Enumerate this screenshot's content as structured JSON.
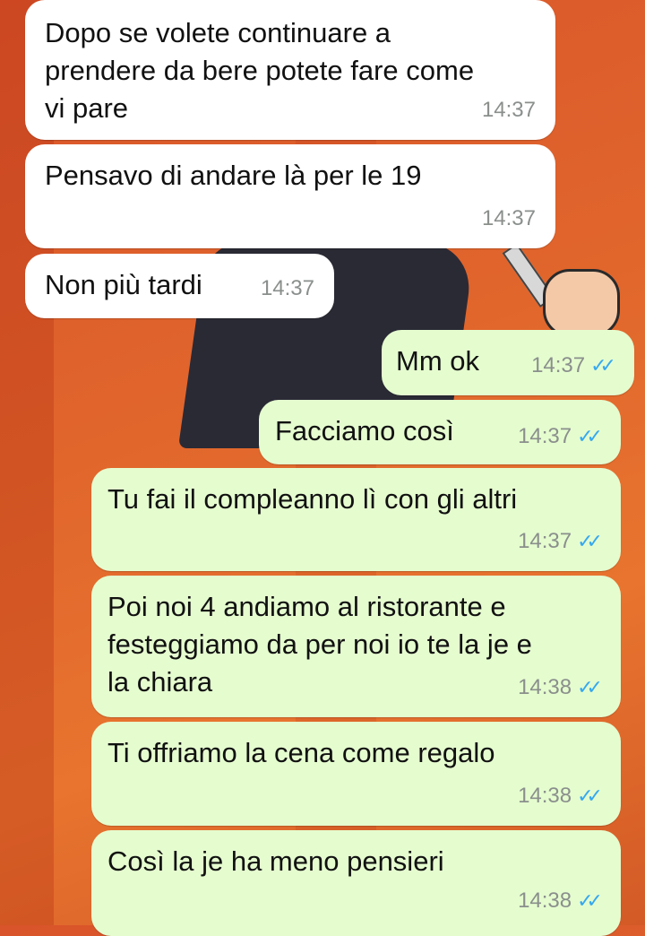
{
  "messages": [
    {
      "direction": "in",
      "text": "Dopo se volete continuare a\nprendere da bere potete fare come\nvi pare",
      "time": "14:37"
    },
    {
      "direction": "in",
      "text": "Pensavo di andare là per le 19",
      "time": "14:37"
    },
    {
      "direction": "in",
      "text": "Non più tardi",
      "time": "14:37"
    },
    {
      "direction": "out",
      "text": "Mm ok",
      "time": "14:37",
      "status": "read"
    },
    {
      "direction": "out",
      "text": "Facciamo così",
      "time": "14:37",
      "status": "read"
    },
    {
      "direction": "out",
      "text": "Tu fai il compleanno lì con gli altri",
      "time": "14:37",
      "status": "read"
    },
    {
      "direction": "out",
      "text": "Poi noi 4 andiamo al ristorante e\nfesteggiamo da per noi io te la je e\nla chiara",
      "time": "14:38",
      "status": "read"
    },
    {
      "direction": "out",
      "text": "Ti offriamo la cena come regalo",
      "time": "14:38",
      "status": "read"
    },
    {
      "direction": "out",
      "text": "Così la je ha meno pensieri",
      "time": "14:38",
      "status": "read"
    }
  ],
  "colors": {
    "incoming_bubble": "#ffffff",
    "outgoing_bubble": "#e5fccf",
    "read_tick": "#36a8f0",
    "wallpaper": "#e0652c"
  },
  "icons": {
    "read_receipt": "double-check-icon"
  }
}
